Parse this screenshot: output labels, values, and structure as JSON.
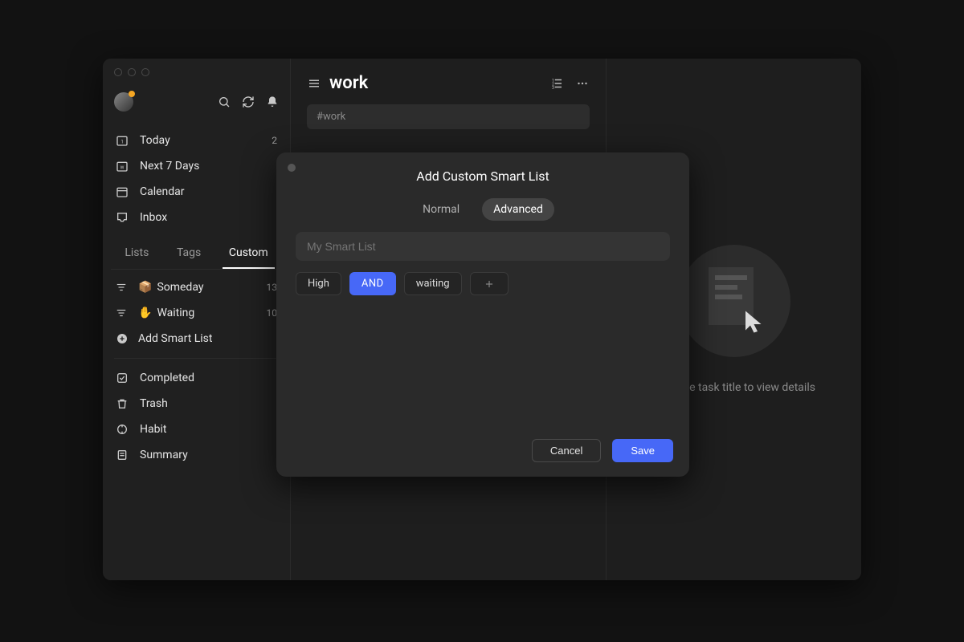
{
  "sidebar": {
    "nav": [
      {
        "label": "Today",
        "count": "2",
        "icon": "calendar-today"
      },
      {
        "label": "Next 7 Days",
        "count": "",
        "icon": "calendar-week"
      },
      {
        "label": "Calendar",
        "count": "",
        "icon": "calendar"
      },
      {
        "label": "Inbox",
        "count": "",
        "icon": "inbox"
      }
    ],
    "tabs": [
      "Lists",
      "Tags",
      "Custom"
    ],
    "active_tab": "Custom",
    "custom_lists": [
      {
        "emoji": "📦",
        "label": "Someday",
        "count": "13",
        "icon": "filter"
      },
      {
        "emoji": "✋",
        "label": "Waiting",
        "count": "10",
        "icon": "filter"
      }
    ],
    "add_smart_list": "Add Smart List",
    "bottom": [
      {
        "label": "Completed",
        "icon": "check"
      },
      {
        "label": "Trash",
        "icon": "trash"
      },
      {
        "label": "Habit",
        "icon": "target"
      },
      {
        "label": "Summary",
        "icon": "summary"
      }
    ]
  },
  "content": {
    "title": "work",
    "search": "#work"
  },
  "detail": {
    "hint": "Click the task title to view details"
  },
  "modal": {
    "title": "Add Custom Smart List",
    "tabs": [
      "Normal",
      "Advanced"
    ],
    "active_tab": "Advanced",
    "name_placeholder": "My Smart List",
    "chips": [
      {
        "label": "High",
        "type": "plain"
      },
      {
        "label": "AND",
        "type": "and"
      },
      {
        "label": "waiting",
        "type": "plain"
      }
    ],
    "cancel": "Cancel",
    "save": "Save"
  }
}
